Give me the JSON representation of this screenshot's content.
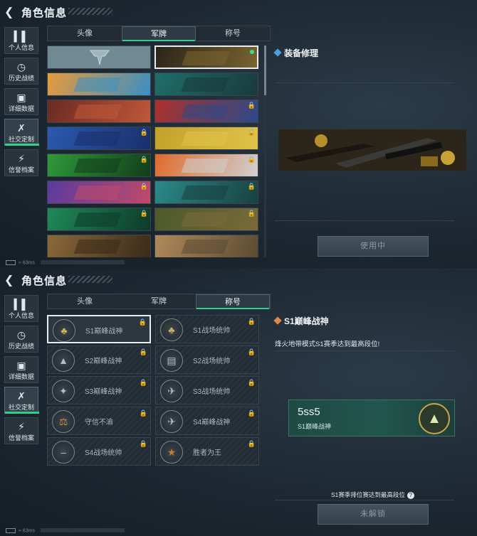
{
  "app": {
    "title": "角色信息"
  },
  "nav": [
    {
      "label": "个人信息",
      "icon": "bar-chart-icon"
    },
    {
      "label": "历史战绩",
      "icon": "clock-icon"
    },
    {
      "label": "详细数据",
      "icon": "folder-icon"
    },
    {
      "label": "社交定制",
      "icon": "tools-icon"
    },
    {
      "label": "信誉档案",
      "icon": "shield-bolt-icon"
    }
  ],
  "tabs": [
    {
      "label": "头像"
    },
    {
      "label": "军牌"
    },
    {
      "label": "称号"
    }
  ],
  "screen1": {
    "active_tab": "军牌",
    "selected": {
      "name": "装备修理",
      "button": "使用中"
    },
    "cards": [
      {
        "art": "logo",
        "locked": false,
        "equipped": false
      },
      {
        "art": "weapons",
        "locked": false,
        "equipped": true
      },
      {
        "art": "orange-abstract",
        "locked": false,
        "equipped": false
      },
      {
        "art": "teal-mech",
        "locked": false,
        "equipped": false
      },
      {
        "art": "squad-red",
        "locked": false,
        "equipped": false
      },
      {
        "art": "red-blue-fire",
        "locked": true,
        "equipped": false
      },
      {
        "art": "blue-stars",
        "locked": true,
        "equipped": false
      },
      {
        "art": "yellow-gun",
        "locked": true,
        "equipped": false
      },
      {
        "art": "green-swirl",
        "locked": true,
        "equipped": false
      },
      {
        "art": "orange-target",
        "locked": true,
        "equipped": false
      },
      {
        "art": "purple-device",
        "locked": true,
        "equipped": false
      },
      {
        "art": "teal-bat",
        "locked": true,
        "equipped": false
      },
      {
        "art": "green-axe",
        "locked": true,
        "equipped": false
      },
      {
        "art": "camo-tank",
        "locked": true,
        "equipped": false
      },
      {
        "art": "desert-soldier",
        "locked": false,
        "equipped": false
      },
      {
        "art": "desert-tank",
        "locked": false,
        "equipped": false
      }
    ]
  },
  "screen2": {
    "active_tab": "称号",
    "selected": {
      "name": "S1巅峰战神",
      "desc": "烽火地带模式S1赛季达到最高段位!",
      "badge_code": "5ss5",
      "badge_sub": "S1巅峰战神",
      "requirement": "S1赛季排位赛达到最高段位",
      "button": "未解锁"
    },
    "titles": [
      {
        "name": "S1巅峰战神",
        "icon": "crocodile-icon",
        "locked": true
      },
      {
        "name": "S1战场统帅",
        "icon": "crocodile-icon",
        "locked": true
      },
      {
        "name": "S2巅峰战神",
        "icon": "triangle-emblem-icon",
        "locked": true
      },
      {
        "name": "S2战场统帅",
        "icon": "tank-icon",
        "locked": true
      },
      {
        "name": "S3巅峰战神",
        "icon": "eagle-icon",
        "locked": true
      },
      {
        "name": "S3战场统帅",
        "icon": "helicopter-icon",
        "locked": true
      },
      {
        "name": "守信不渝",
        "icon": "scales-icon",
        "locked": true
      },
      {
        "name": "S4巅峰战神",
        "icon": "jet-icon",
        "locked": true
      },
      {
        "name": "S4战场统帅",
        "icon": "rifle-icon",
        "locked": true
      },
      {
        "name": "胜者为王",
        "icon": "medal-icon",
        "locked": true
      }
    ]
  },
  "status": {
    "ping": "63ms"
  },
  "colors": {
    "accent": "#2fd08a",
    "panel": "#2a343d",
    "badge_bg": "#21564d"
  }
}
